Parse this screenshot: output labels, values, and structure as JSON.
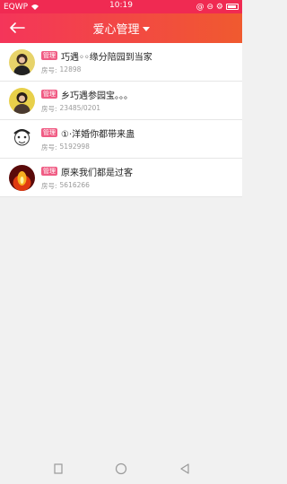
{
  "status_bar": {
    "carrier": "EQWP",
    "time": "10:19",
    "right_text": "@ ⊖ ⚙"
  },
  "header": {
    "title": "爱心管理",
    "back_icon": "arrow-left-icon",
    "dropdown_icon": "caret-down-icon"
  },
  "list": {
    "items": [
      {
        "tag": "管理",
        "name": "巧遇◦◦缘分陪园到当家",
        "room_label": "房号:",
        "room": "12898"
      },
      {
        "tag": "管理",
        "name": "乡巧遇参园宝。。。",
        "room_label": "房号:",
        "room": "23485/0201"
      },
      {
        "tag": "管理",
        "name": "①·洋婚你都带来蛊",
        "room_label": "房号:",
        "room": "5192998"
      },
      {
        "tag": "管理",
        "name": "原来我们都是过客",
        "room_label": "房号:",
        "room": "5616266"
      }
    ]
  },
  "navbar": {
    "buttons": [
      "square-icon",
      "circle-icon",
      "triangle-back-icon"
    ]
  },
  "colors": {
    "accent_red": "#f02a52",
    "tag_pink": "#f05c84"
  }
}
